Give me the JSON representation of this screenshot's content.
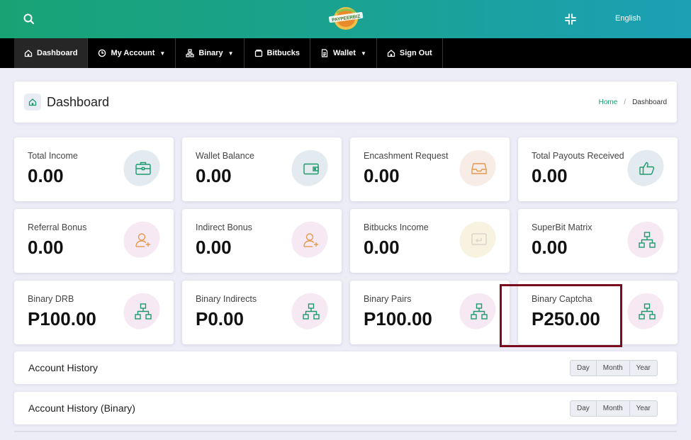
{
  "header": {
    "logo_text": "PAYPEERBIZ",
    "language": "English",
    "icons": {
      "search": "search-icon",
      "compress": "compress-icon"
    }
  },
  "nav": {
    "items": [
      {
        "label": "Dashboard",
        "icon": "home-icon",
        "dropdown": false
      },
      {
        "label": "My Account",
        "icon": "clock-icon",
        "dropdown": true
      },
      {
        "label": "Binary",
        "icon": "sitemap-icon",
        "dropdown": true
      },
      {
        "label": "Bitbucks",
        "icon": "wallet-icon",
        "dropdown": false
      },
      {
        "label": "Wallet",
        "icon": "document-icon",
        "dropdown": true
      },
      {
        "label": "Sign Out",
        "icon": "home-icon",
        "dropdown": false
      }
    ]
  },
  "page": {
    "title": "Dashboard",
    "breadcrumb": [
      "Home",
      "Dashboard"
    ]
  },
  "stats": [
    {
      "label": "Total Income",
      "value": "0.00",
      "icon": "briefcase-icon",
      "tint": "blue"
    },
    {
      "label": "Wallet Balance",
      "value": "0.00",
      "icon": "wallet-icon",
      "tint": "blue"
    },
    {
      "label": "Encashment Request",
      "value": "0.00",
      "icon": "inbox-icon",
      "tint": "orange"
    },
    {
      "label": "Total Payouts Received",
      "value": "0.00",
      "icon": "thumbs-up-icon",
      "tint": "blue"
    },
    {
      "label": "Referral Bonus",
      "value": "0.00",
      "icon": "user-plus-icon",
      "tint": "pink"
    },
    {
      "label": "Indirect Bonus",
      "value": "0.00",
      "icon": "user-plus-icon",
      "tint": "pink"
    },
    {
      "label": "Bitbucks Income",
      "value": "0.00",
      "icon": "exchange-icon",
      "tint": "yellow"
    },
    {
      "label": "SuperBit Matrix",
      "value": "0.00",
      "icon": "sitemap-icon",
      "tint": "pink"
    },
    {
      "label": "Binary DRB",
      "value": "P100.00",
      "icon": "sitemap-icon",
      "tint": "pink"
    },
    {
      "label": "Binary Indirects",
      "value": "P0.00",
      "icon": "sitemap-icon",
      "tint": "pink"
    },
    {
      "label": "Binary Pairs",
      "value": "P100.00",
      "icon": "sitemap-icon",
      "tint": "pink"
    },
    {
      "label": "Binary Captcha",
      "value": "P250.00",
      "icon": "sitemap-icon",
      "tint": "pink"
    }
  ],
  "history": [
    {
      "title": "Account History",
      "periods": [
        "Day",
        "Month",
        "Year"
      ]
    },
    {
      "title": "Account History (Binary)",
      "periods": [
        "Day",
        "Month",
        "Year"
      ]
    }
  ],
  "colors": {
    "accent_green": "#1d9a6c",
    "highlight": "#7a0b1c",
    "nav_bg": "#000000"
  }
}
